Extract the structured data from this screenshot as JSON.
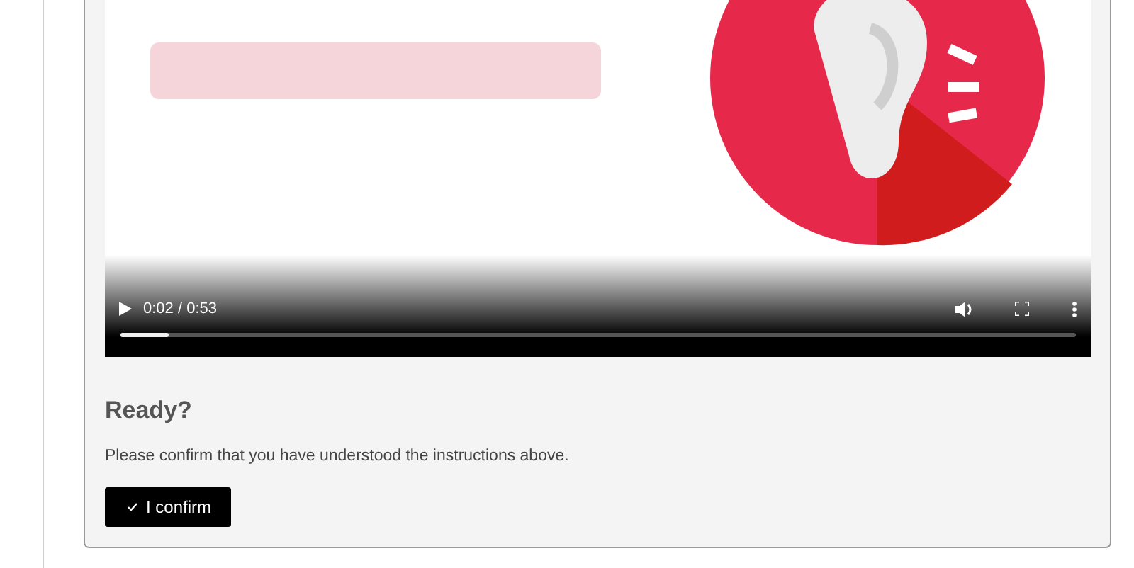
{
  "video": {
    "kind": "picture",
    "time": "0:02 / 0:53",
    "level": 0.05
  },
  "confirm": {
    "heading": "Ready?",
    "text": "Please confirm that you have understood the instructions above.",
    "button": "I confirm"
  }
}
